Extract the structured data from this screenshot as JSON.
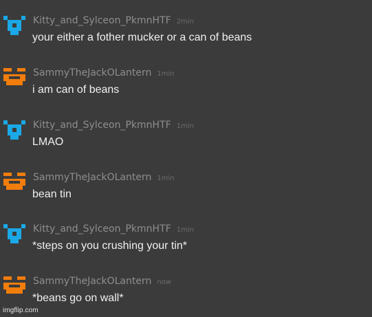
{
  "colors": {
    "background": "#3b3b3b",
    "avatar_cyan": "#1aa9e6",
    "avatar_orange": "#f27d0c",
    "username": "#8e8e8e",
    "timestamp": "#6c6c6c",
    "message_text": "#f0f0f0"
  },
  "messages": [
    {
      "username": "Kitty_and_Sylceon_PkmnHTF",
      "time": "2min",
      "text": "your either a fother mucker or a can of beans",
      "avatar_icon": "cyan-pixel-avatar-icon"
    },
    {
      "username": "SammyTheJackOLantern",
      "time": "1min",
      "text": "i am can of beans",
      "avatar_icon": "orange-pixel-avatar-icon"
    },
    {
      "username": "Kitty_and_Sylceon_PkmnHTF",
      "time": "1min",
      "text": "LMAO",
      "avatar_icon": "cyan-pixel-avatar-icon"
    },
    {
      "username": "SammyTheJackOLantern",
      "time": "1min",
      "text": "bean tin",
      "avatar_icon": "orange-pixel-avatar-icon"
    },
    {
      "username": "Kitty_and_Sylceon_PkmnHTF",
      "time": "1min",
      "text": "*steps on you crushing your tin*",
      "avatar_icon": "cyan-pixel-avatar-icon"
    },
    {
      "username": "SammyTheJackOLantern",
      "time": "now",
      "text": "*beans go on wall*",
      "avatar_icon": "orange-pixel-avatar-icon"
    }
  ],
  "watermark": "imgflip.com"
}
